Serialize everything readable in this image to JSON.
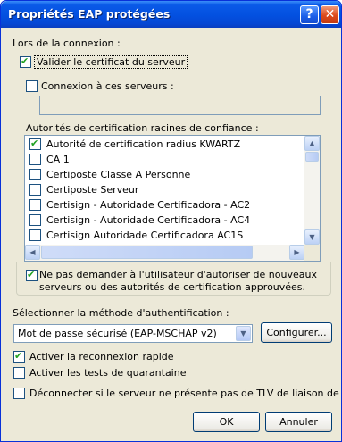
{
  "window": {
    "title": "Propriétés EAP protégées",
    "help_glyph": "?",
    "close_glyph": "✕"
  },
  "connection": {
    "heading": "Lors de la connexion :",
    "validate_cert": {
      "label": "Valider le certificat du serveur",
      "checked": true
    },
    "connect_servers": {
      "label": "Connexion à ces serveurs :",
      "checked": false,
      "value": ""
    }
  },
  "trusted_ca": {
    "heading": "Autorités de certification racines de confiance :",
    "items": [
      {
        "label": "Autorité de certification radius KWARTZ",
        "checked": true
      },
      {
        "label": "CA 1",
        "checked": false
      },
      {
        "label": "Certiposte Classe A Personne",
        "checked": false
      },
      {
        "label": "Certiposte Serveur",
        "checked": false
      },
      {
        "label": "Certisign - Autoridade Certificadora - AC2",
        "checked": false
      },
      {
        "label": "Certisign - Autoridade Certificadora - AC4",
        "checked": false
      },
      {
        "label": "Certisign Autoridade Certificadora AC1S",
        "checked": false
      }
    ],
    "scroll_up_icon": "▲",
    "scroll_down_icon": "▼",
    "scroll_left_icon": "◀",
    "scroll_right_icon": "▶"
  },
  "no_prompt": {
    "line1": "Ne pas demander à l'utilisateur d'autoriser de nouveaux",
    "line2": "serveurs ou des autorités de certification approuvées.",
    "checked": true
  },
  "auth_method": {
    "heading": "Sélectionner la méthode d'authentification :",
    "selected": "Mot de passe sécurisé (EAP-MSCHAP v2)",
    "dropdown_icon": "▼",
    "configure_label": "Configurer..."
  },
  "options": {
    "fast_reconnect": {
      "label": "Activer la reconnexion rapide",
      "checked": true
    },
    "quarantine": {
      "label": "Activer les tests de quarantaine",
      "checked": false
    },
    "disconnect_tlv": {
      "label": "Déconnecter si le serveur ne présente pas de TLV de liaison de chiffrement",
      "checked": false
    }
  },
  "buttons": {
    "ok": "OK",
    "cancel": "Annuler"
  },
  "colors": {
    "title_bar": "#0a5ae8",
    "dialog_bg": "#ece9d8",
    "selection_check": "#21a121"
  }
}
